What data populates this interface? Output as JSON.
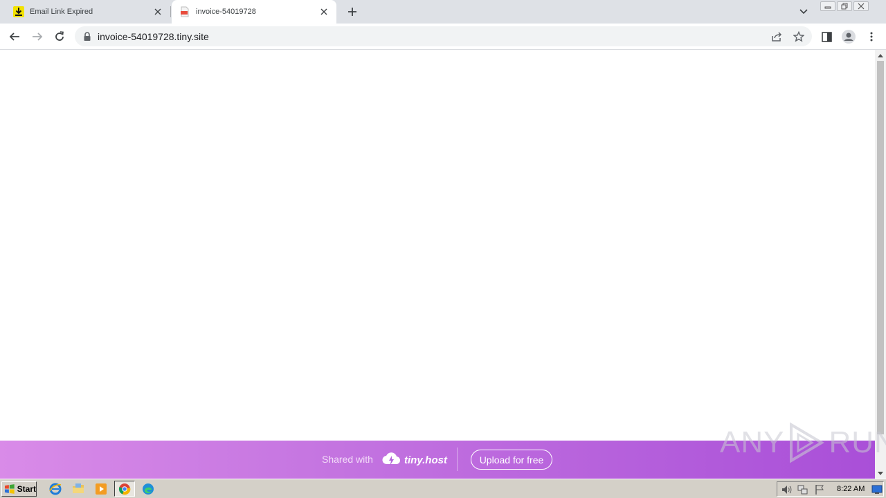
{
  "browser": {
    "tabs": [
      {
        "title": "Email Link Expired",
        "icon": "download-icon",
        "active": false
      },
      {
        "title": "invoice-54019728",
        "icon": "pdf-file-icon",
        "active": true
      }
    ],
    "address_bar": {
      "url": "invoice-54019728.tiny.site"
    }
  },
  "banner": {
    "shared_label": "Shared with",
    "brand": "tiny.host",
    "upload_label": "Upload for free"
  },
  "watermark": {
    "left": "ANY",
    "right": "RUN"
  },
  "taskbar": {
    "start_label": "Start",
    "clock": "8:22 AM"
  },
  "colors": {
    "banner_start": "#d98be8",
    "banner_end": "#a94fd8",
    "tab_strip": "#dee1e6"
  }
}
